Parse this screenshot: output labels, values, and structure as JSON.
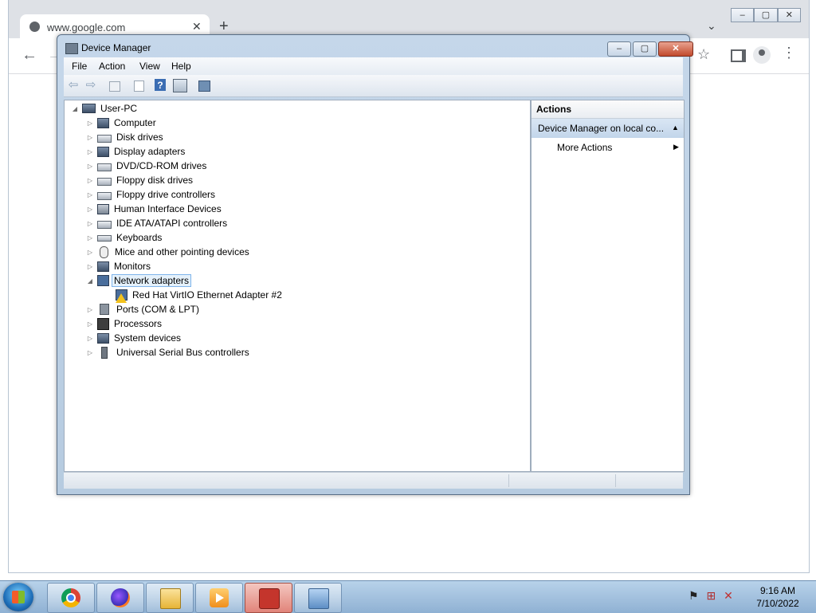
{
  "browser": {
    "tab_title": "www.google.com",
    "tab_close": "✕",
    "new_tab": "+",
    "tab_search": "⌄",
    "back": "←",
    "forward": "→",
    "bookmark": "☆",
    "menu": "⋮",
    "win_min": "–",
    "win_max": "▢",
    "win_close": "✕"
  },
  "window": {
    "title": "Device Manager",
    "min": "–",
    "max": "▢",
    "close": "✕"
  },
  "menu": {
    "file": "File",
    "action": "Action",
    "view": "View",
    "help": "Help"
  },
  "toolbar": {
    "back": "⇦",
    "forward": "⇨",
    "help": "?"
  },
  "tree": {
    "root": "User-PC",
    "items": [
      {
        "label": "Computer",
        "icon": "computer-icon",
        "expander": "▷"
      },
      {
        "label": "Disk drives",
        "icon": "disk-drive-icon",
        "expander": "▷"
      },
      {
        "label": "Display adapters",
        "icon": "display-adapter-icon",
        "expander": "▷"
      },
      {
        "label": "DVD/CD-ROM drives",
        "icon": "dvd-drive-icon",
        "expander": "▷"
      },
      {
        "label": "Floppy disk drives",
        "icon": "floppy-drive-icon",
        "expander": "▷"
      },
      {
        "label": "Floppy drive controllers",
        "icon": "floppy-controller-icon",
        "expander": "▷"
      },
      {
        "label": "Human Interface Devices",
        "icon": "hid-icon",
        "expander": "▷"
      },
      {
        "label": "IDE ATA/ATAPI controllers",
        "icon": "ide-controller-icon",
        "expander": "▷"
      },
      {
        "label": "Keyboards",
        "icon": "keyboard-icon",
        "expander": "▷"
      },
      {
        "label": "Mice and other pointing devices",
        "icon": "mouse-icon",
        "expander": "▷"
      },
      {
        "label": "Monitors",
        "icon": "monitor-icon",
        "expander": "▷"
      },
      {
        "label": "Network adapters",
        "icon": "network-adapter-icon",
        "expander": "◢",
        "selected": true
      },
      {
        "label": "Red Hat VirtIO Ethernet Adapter #2",
        "icon": "warning-device-icon",
        "child": true
      },
      {
        "label": "Ports (COM & LPT)",
        "icon": "port-icon",
        "expander": "▷"
      },
      {
        "label": "Processors",
        "icon": "processor-icon",
        "expander": "▷"
      },
      {
        "label": "System devices",
        "icon": "system-device-icon",
        "expander": "▷"
      },
      {
        "label": "Universal Serial Bus controllers",
        "icon": "usb-icon",
        "expander": "▷"
      }
    ],
    "root_expander": "◢"
  },
  "actions": {
    "header": "Actions",
    "section": "Device Manager on local co...",
    "section_arrow": "▲",
    "more": "More Actions",
    "more_arrow": "▶"
  },
  "tray": {
    "flag": "⚑",
    "network": "⊞",
    "volume": "✕"
  },
  "clock": {
    "time": "9:16 AM",
    "date": "7/10/2022"
  }
}
